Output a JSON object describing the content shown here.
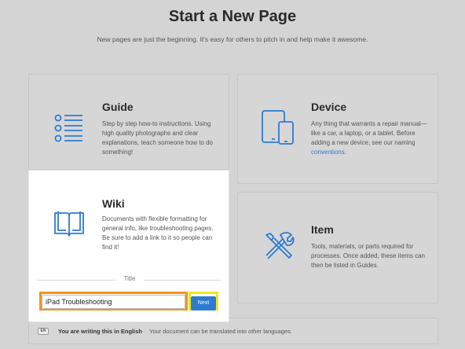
{
  "header": {
    "title": "Start a New Page",
    "subtitle": "New pages are just the beginning. It's easy for others to pitch in and help make it awesome."
  },
  "cards": {
    "guide": {
      "title": "Guide",
      "description": "Step by step how-to instructions. Using high quality photographs and clear explanations, teach someone how to do something!",
      "icon": "list-icon"
    },
    "device": {
      "title": "Device",
      "description_before": "Any thing that warrants a repair manual—like a car, a laptop, or a tablet. Before adding a new device, see our naming ",
      "link": "conventions",
      "description_after": ".",
      "icon": "devices-icon"
    },
    "wiki": {
      "title": "Wiki",
      "description": "Documents with flexible formatting for general info, like troubleshooting pages. Be sure to add a link to it so people can find it!",
      "icon": "book-icon",
      "title_label": "Title",
      "title_value": "iPad Troubleshooting",
      "next_label": "Next"
    },
    "item": {
      "title": "Item",
      "description": "Tools, materials, or parts required for processes. Once added, these items can then be listed in Guides.",
      "icon": "tools-icon"
    }
  },
  "language_bar": {
    "badge": "EN",
    "main": "You are writing this in English",
    "note": "Your document can be translated into other languages."
  },
  "colors": {
    "accent": "#2d7bd1",
    "highlight_input": "#f0961e",
    "highlight_button": "#f3e41b",
    "background": "#d4d4d4"
  }
}
